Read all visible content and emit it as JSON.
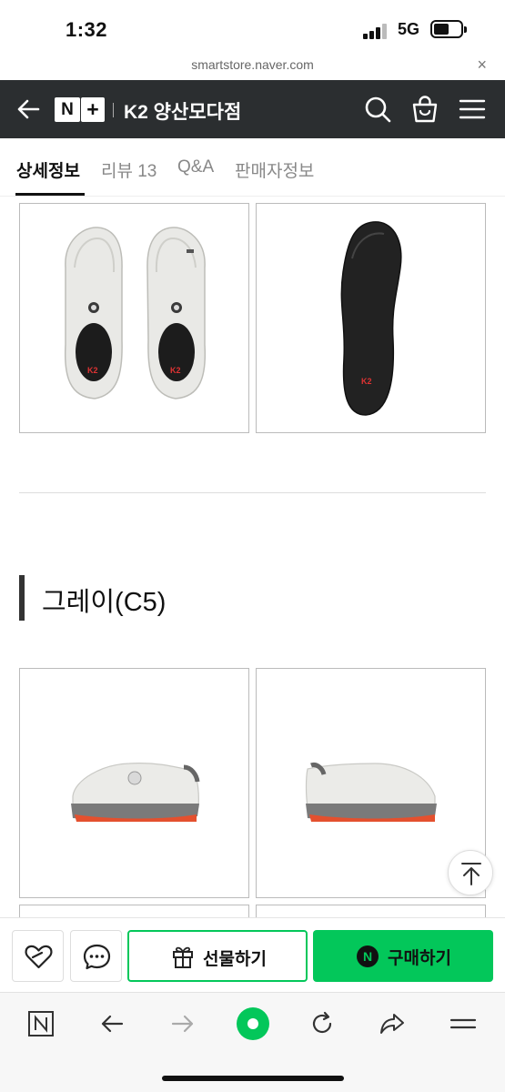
{
  "status": {
    "time": "1:32",
    "network": "5G"
  },
  "browser": {
    "url": "smartstore.naver.com",
    "close_symbol": "×"
  },
  "header": {
    "logo_n": "N",
    "logo_plus": "+",
    "store_name": "K2 양산모다점",
    "icons": [
      "back-arrow-icon",
      "search-icon",
      "cart-icon",
      "menu-icon"
    ]
  },
  "tabs": [
    {
      "label": "상세정보",
      "active": true
    },
    {
      "label": "리뷰 13",
      "active": false
    },
    {
      "label": "Q&A",
      "active": false
    },
    {
      "label": "판매자정보",
      "active": false
    }
  ],
  "product": {
    "logo_text": "K2",
    "section_title": "그레이(C5)"
  },
  "buy_bar": {
    "gift_label": "선물하기",
    "buy_badge": "N",
    "buy_label": "구매하기",
    "accent": "#03c75a"
  },
  "toolbar": {
    "icons": [
      "naver-home-icon",
      "back-icon",
      "forward-icon",
      "green-dot-icon",
      "refresh-icon",
      "share-icon",
      "menu-icon"
    ]
  }
}
